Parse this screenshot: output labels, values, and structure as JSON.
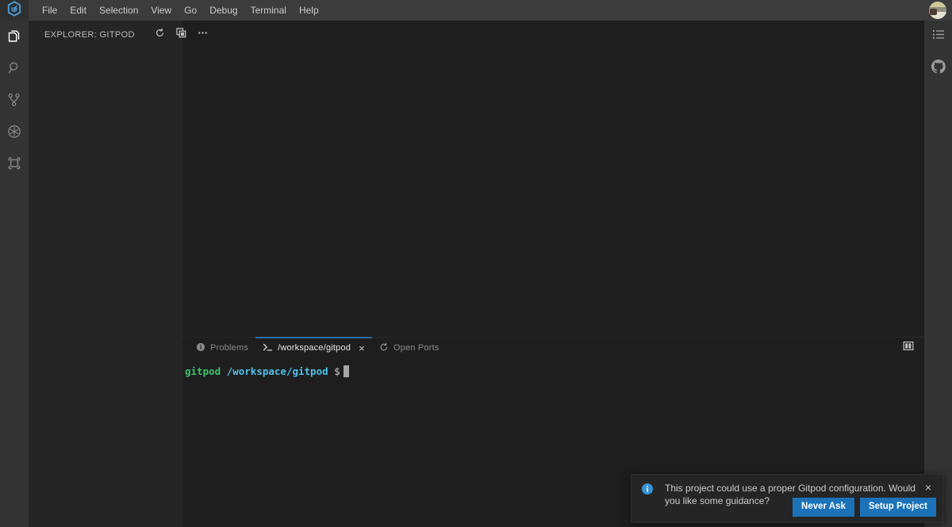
{
  "window": {
    "logo_icon": "gitpod-hexagon-logo",
    "logo_color": "#4a9ddb",
    "menu": [
      {
        "label": "File",
        "name": "menu-file"
      },
      {
        "label": "Edit",
        "name": "menu-edit"
      },
      {
        "label": "Selection",
        "name": "menu-selection"
      },
      {
        "label": "View",
        "name": "menu-view"
      },
      {
        "label": "Go",
        "name": "menu-go"
      },
      {
        "label": "Debug",
        "name": "menu-debug"
      },
      {
        "label": "Terminal",
        "name": "menu-terminal"
      },
      {
        "label": "Help",
        "name": "menu-help"
      }
    ],
    "avatar_icon": "user-avatar"
  },
  "activity_bar_left": {
    "items": [
      {
        "icon": "files-explorer-icon",
        "active": true
      },
      {
        "icon": "search-icon",
        "active": false
      },
      {
        "icon": "source-control-branch-icon",
        "active": false
      },
      {
        "icon": "run-and-debug-icon",
        "active": false
      },
      {
        "icon": "extensions-icon",
        "active": false
      }
    ]
  },
  "activity_bar_right": {
    "items": [
      {
        "icon": "outline-list-icon"
      },
      {
        "icon": "github-octocat-icon"
      }
    ]
  },
  "sidebar": {
    "title": "EXPLORER: GITPOD",
    "actions": [
      {
        "icon": "refresh-icon",
        "name": "refresh-explorer-button"
      },
      {
        "icon": "collapse-all-icon",
        "name": "collapse-all-button"
      },
      {
        "icon": "more-actions-ellipsis-icon",
        "name": "more-actions-button"
      }
    ]
  },
  "panel": {
    "tabs": [
      {
        "label": "Problems",
        "icon": "info-circle-icon",
        "active": false,
        "closable": false
      },
      {
        "label": "/workspace/gitpod",
        "icon": "terminal-prompt-icon",
        "active": true,
        "closable": true
      },
      {
        "label": "Open Ports",
        "icon": "circle-arrow-icon",
        "active": false,
        "closable": false
      }
    ],
    "close_label": "×",
    "actions": [
      {
        "icon": "split-panel-icon",
        "name": "maximize-panel-button"
      }
    ],
    "active_tab_underline_color": "#2f6ea8"
  },
  "terminal": {
    "user": "gitpod",
    "path": "/workspace/gitpod",
    "symbol": "$",
    "user_color": "#3ec46d",
    "path_color": "#4fc1e9"
  },
  "notification": {
    "icon": "info-circle-icon",
    "message": "This project could use a proper Gitpod configuration. Would you like some guidance?",
    "close_label": "×",
    "buttons": [
      {
        "label": "Never Ask",
        "name": "never-ask-button"
      },
      {
        "label": "Setup Project",
        "name": "setup-project-button"
      }
    ],
    "button_color": "#1b72b8"
  }
}
